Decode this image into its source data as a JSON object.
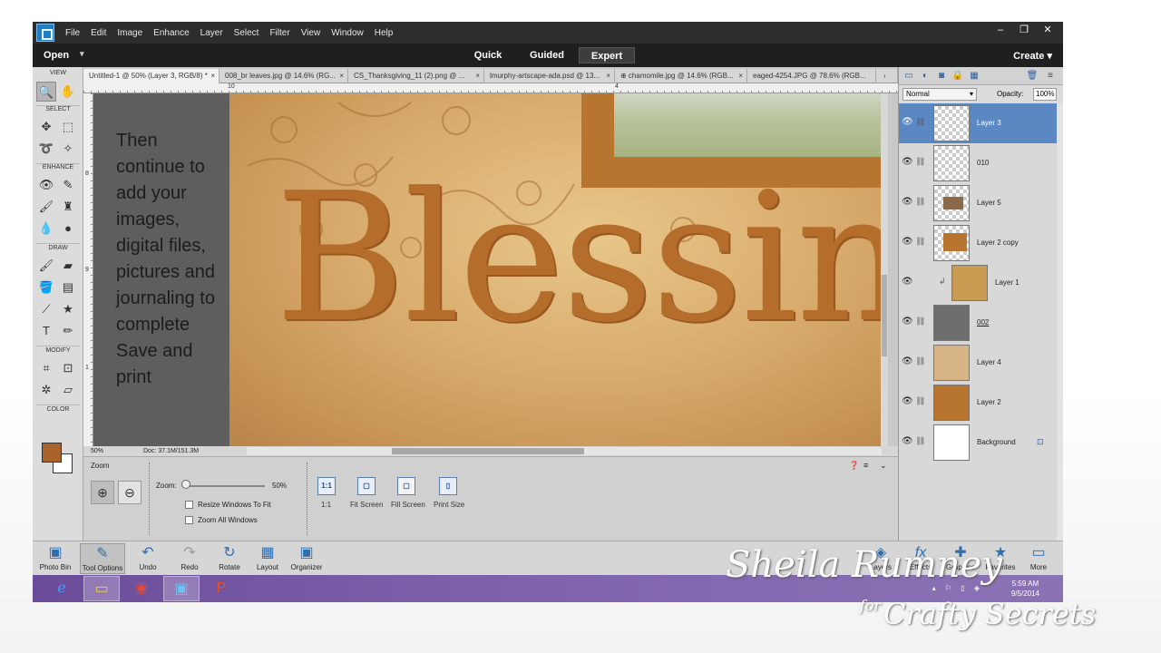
{
  "menubar": {
    "items": [
      "File",
      "Edit",
      "Image",
      "Enhance",
      "Layer",
      "Select",
      "Filter",
      "View",
      "Window",
      "Help"
    ],
    "controls": [
      "–",
      "❐",
      "✕"
    ]
  },
  "modebar": {
    "open": "Open",
    "modes": [
      "Quick",
      "Guided",
      "Expert"
    ],
    "active_mode": "Expert",
    "create": "Create"
  },
  "tools": {
    "sections": [
      "VIEW",
      "SELECT",
      "ENHANCE",
      "DRAW",
      "MODIFY",
      "COLOR"
    ],
    "foreground_color": "#a8642a",
    "background_color": "#ffffff"
  },
  "doc_tabs": [
    "Untitled-1 @ 50% (Layer 3, RGB/8) *",
    "008_br leaves.jpg @ 14.6% (RG...",
    "CS_Thanksgiving_11 (2).png @ ...",
    "lmurphy-artscape-ada.psd @ 13...",
    "⊕ chamomile.jpg @ 14.6% (RGB...",
    "eaged-4254.JPG @ 78.6% (RGB..."
  ],
  "rulers": {
    "top": [
      "10",
      "4"
    ],
    "left": [
      "8",
      "9",
      "1"
    ]
  },
  "canvas": {
    "instruction_lines": [
      "Then",
      "continue to",
      "add your",
      "images,",
      "digital files,",
      "pictures and",
      "journaling to",
      "complete",
      "Save and",
      "print"
    ],
    "title_word": "Blessing"
  },
  "statusbar": {
    "zoom": "50%",
    "doc": "Doc: 37.1M/151.3M"
  },
  "tool_options": {
    "title": "Zoom",
    "zoom_label": "Zoom:",
    "zoom_value": "50%",
    "zoom_level": 0.5,
    "checkbox_resize": "Resize Windows To Fit",
    "checkbox_zoom_all": "Zoom All Windows",
    "view_buttons": [
      "1:1",
      "Fit Screen",
      "Fill Screen",
      "Print Size"
    ]
  },
  "layers_panel": {
    "blend_mode": "Normal",
    "opacity_label": "Opacity:",
    "opacity_value": "100%",
    "layers": [
      {
        "name": "Layer 3",
        "selected": true
      },
      {
        "name": "010",
        "selected": false
      },
      {
        "name": "Layer 5",
        "selected": false
      },
      {
        "name": "Layer 2 copy",
        "selected": false
      },
      {
        "name": "Layer 1",
        "selected": false
      },
      {
        "name": "002",
        "selected": false
      },
      {
        "name": "Layer 4",
        "selected": false
      },
      {
        "name": "Layer 2",
        "selected": false
      },
      {
        "name": "Background",
        "selected": false
      }
    ]
  },
  "taskbar": {
    "left_items": [
      "Photo Bin",
      "Tool Options",
      "Undo",
      "Redo",
      "Rotate",
      "Layout",
      "Organizer"
    ],
    "right_items": [
      "Layers",
      "Effects",
      "Graphics",
      "Favorites",
      "More"
    ]
  },
  "windows_taskbar": {
    "time": "5:59 AM",
    "date": "9/5/2014"
  },
  "watermark": {
    "name": "Sheila Rumney",
    "for": "for",
    "brand": "Crafty Secrets"
  }
}
